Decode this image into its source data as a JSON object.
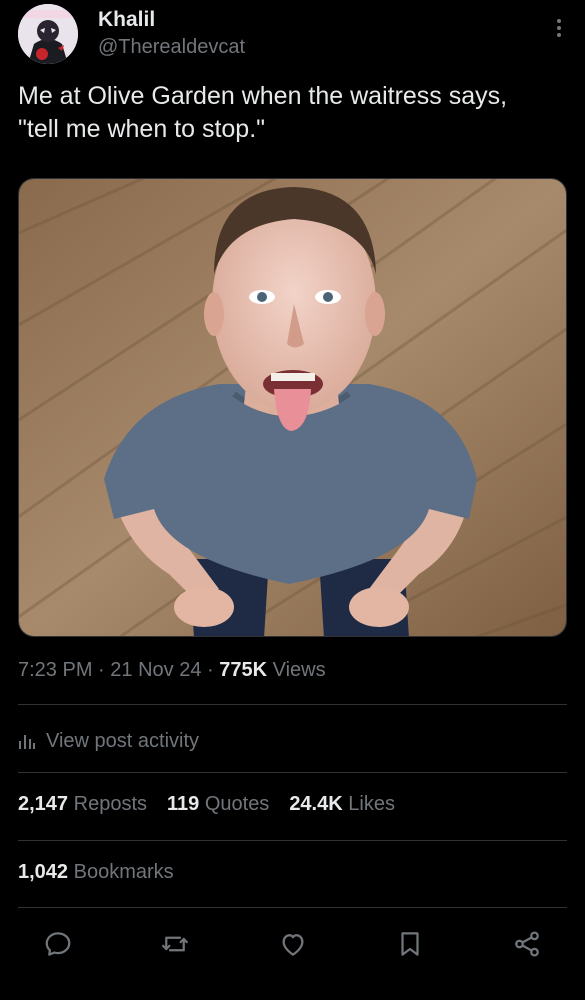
{
  "author": {
    "display_name": "Khalil",
    "handle": "@Therealdevcat"
  },
  "post": {
    "text": "Me at Olive Garden when the waitress says, \"tell me when to stop.\""
  },
  "meta": {
    "time": "7:23 PM",
    "date": "21 Nov 24",
    "views_count": "775K",
    "views_label": "Views",
    "separator": "·"
  },
  "activity": {
    "label": "View post activity",
    "icon": "analytics-icon"
  },
  "stats": {
    "reposts_count": "2,147",
    "reposts_label": "Reposts",
    "quotes_count": "119",
    "quotes_label": "Quotes",
    "likes_count": "24.4K",
    "likes_label": "Likes",
    "bookmarks_count": "1,042",
    "bookmarks_label": "Bookmarks"
  },
  "actions": [
    "reply-icon",
    "repost-icon",
    "like-icon",
    "bookmark-icon",
    "share-icon"
  ],
  "colors": {
    "background": "#000000",
    "primary_text": "#e7e9ea",
    "secondary_text": "#71767b",
    "divider": "#2f3336"
  }
}
